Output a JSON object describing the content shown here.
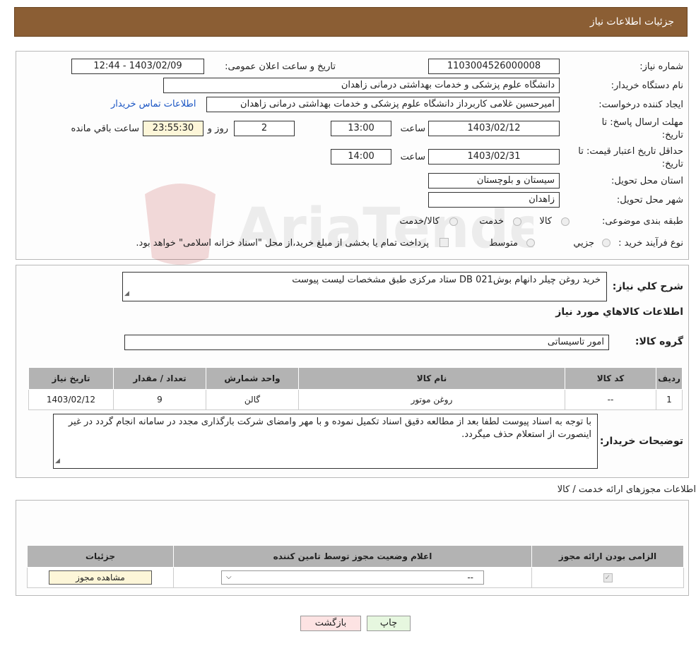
{
  "header": {
    "title": "جزئیات اطلاعات نیاز"
  },
  "watermark": {
    "text": "AriaTender.neT"
  },
  "fields": {
    "need_number_label": "شماره نیاز:",
    "need_number": "1103004526000008",
    "announce_label": "تاریخ و ساعت اعلان عمومی:",
    "announce_value": "1403/02/09 - 12:44",
    "buyer_org_label": "نام دستگاه خریدار:",
    "buyer_org": "دانشگاه علوم پزشکی و خدمات بهداشتی درمانی زاهدان",
    "creator_label": "ایجاد کننده درخواست:",
    "creator": "امیرحسین غلامی کاربرداز دانشگاه علوم پزشکی و خدمات بهداشتی درمانی زاهدان",
    "contact_link": "اطلاعات تماس خریدار",
    "deadline_label_1": "مهلت ارسال پاسخ: تا",
    "deadline_label_2": "تاریخ:",
    "deadline_date": "1403/02/12",
    "time_label": "ساعت",
    "deadline_time": "13:00",
    "days_value": "2",
    "days_label": "روز و",
    "remaining_time": "23:55:30",
    "remaining_label": "ساعت باقي مانده",
    "validity_label_1": "حداقل تاریخ اعتبار قیمت: تا",
    "validity_label_2": "تاریخ:",
    "validity_date": "1403/02/31",
    "validity_time": "14:00",
    "province_label": "استان محل تحویل:",
    "province": "سیستان و بلوچستان",
    "city_label": "شهر محل تحویل:",
    "city": "زاهدان",
    "category_label": "طبقه بندی موضوعی:",
    "category_options": [
      "کالا",
      "خدمت",
      "کالا/خدمت"
    ],
    "process_label": "نوع فرآیند خرید :",
    "process_options": [
      "جزیي",
      "متوسط"
    ],
    "process_note": "پرداخت تمام یا بخشی از مبلغ خرید،از محل \"اسناد خزانه اسلامی\" خواهد بود."
  },
  "description": {
    "label": "شرح کلي نیاز:",
    "text": "خرید روغن چیلر دانهام بوش021 DB ستاد مرکزی طبق مشخصات لیست پیوست",
    "goods_title": "اطلاعات کالاهاي مورد نیاز",
    "group_label": "گروه کالا:",
    "group_value": "امور تاسیساتی"
  },
  "goods_table": {
    "headers": [
      "ردیف",
      "کد کالا",
      "نام کالا",
      "واحد شمارش",
      "تعداد / مقدار",
      "تاریخ نیاز"
    ],
    "rows": [
      [
        "1",
        "--",
        "روغن موتور",
        "گالن",
        "9",
        "1403/02/12"
      ]
    ]
  },
  "buyer_notes": {
    "label": "توضیحات خریدار:",
    "text": "با توجه به اسناد پیوست لطفا بعد از مطالعه دقیق اسناد تکمیل نموده و با مهر وامضای شرکت بارگذاری مجدد در سامانه انجام گردد در غیر اینصورت از استعلام حذف میگردد."
  },
  "licenses": {
    "title": "اطلاعات مجوزهای ارائه خدمت / کالا",
    "headers": [
      "الزامی بودن ارائه مجوز",
      "اعلام وضعیت مجوز توسط تامین کننده",
      "جزئیات"
    ],
    "select_value": "--",
    "view_button": "مشاهده مجوز"
  },
  "buttons": {
    "print": "چاپ",
    "back": "بازگشت"
  },
  "colors": {
    "header_bg": "#8B5E34",
    "table_header": "#b3b3b3",
    "link": "#1a55c4",
    "back_bg": "#fde3e3",
    "print_bg": "#e6f7df"
  }
}
